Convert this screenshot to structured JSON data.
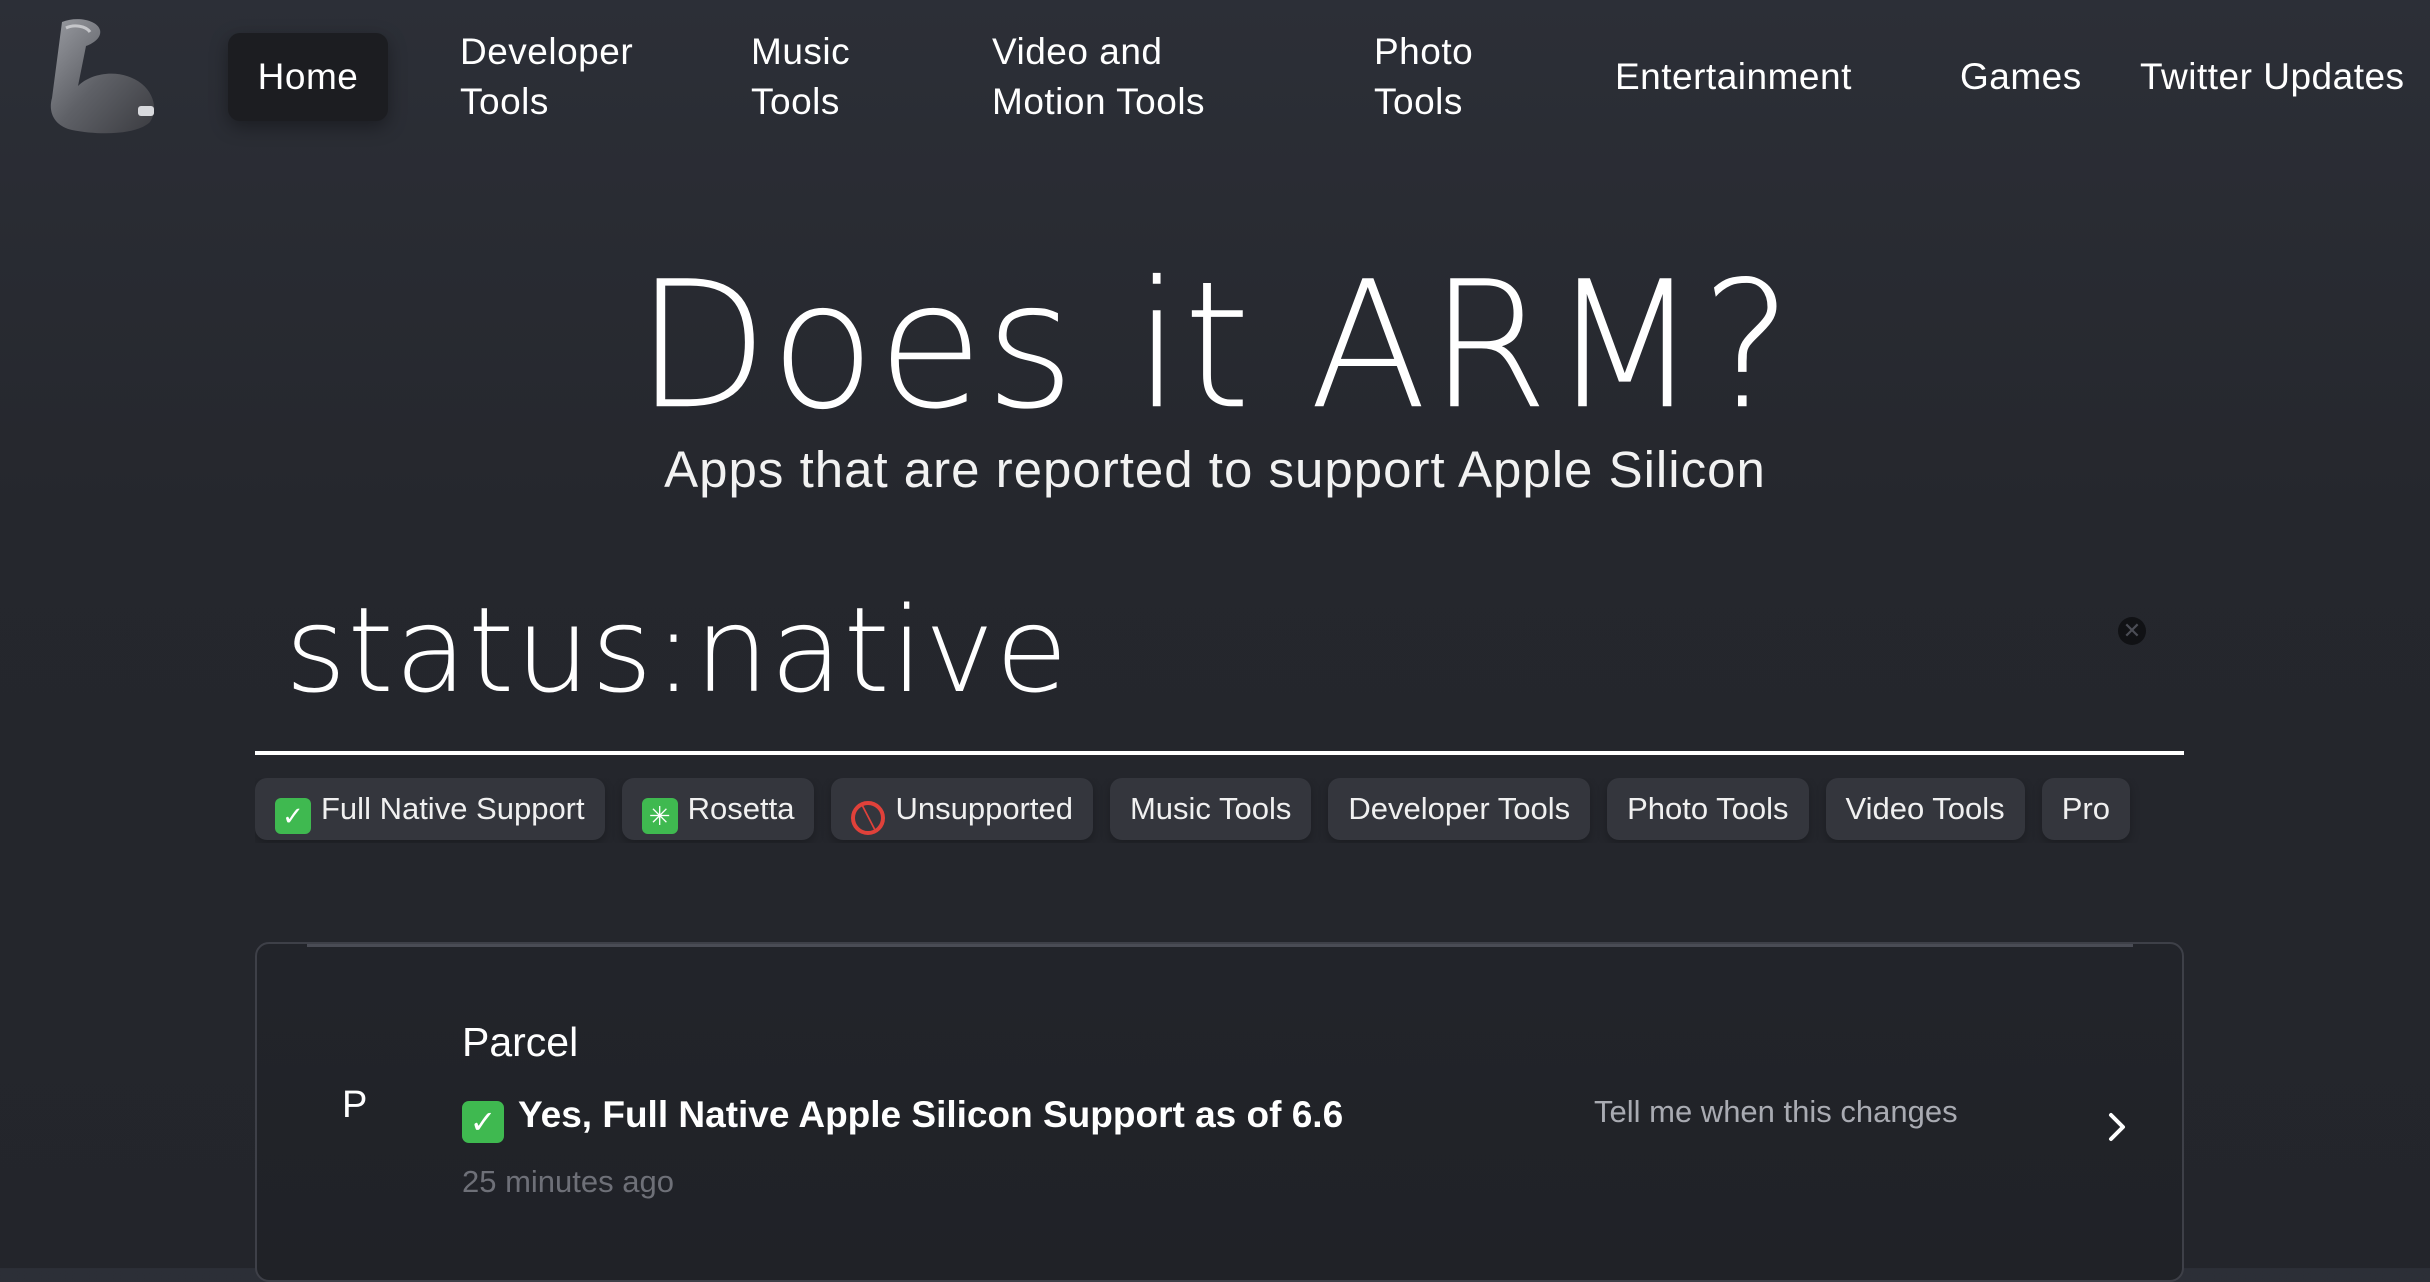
{
  "nav": {
    "logo_icon": "flexed-biceps-icon",
    "items": [
      {
        "label": "Home",
        "active": true
      },
      {
        "label": "Developer Tools"
      },
      {
        "label": "Music Tools"
      },
      {
        "label": "Video and Motion Tools"
      },
      {
        "label": "Photo Tools"
      },
      {
        "label": "Entertainment"
      },
      {
        "label": "Games"
      },
      {
        "label": "Twitter Updates"
      }
    ],
    "lines": {
      "developer": [
        "Developer",
        "Tools"
      ],
      "music": [
        "Music",
        "Tools"
      ],
      "video": [
        "Video and",
        "Motion Tools"
      ],
      "photo": [
        "Photo",
        "Tools"
      ]
    }
  },
  "hero": {
    "title": "Does it ARM?",
    "subtitle": "Apps that are reported to support Apple Silicon"
  },
  "search": {
    "value": "status:native",
    "clear_icon": "close-circle-icon"
  },
  "filters": [
    {
      "label": "Full Native Support",
      "icon": "check-mark-icon"
    },
    {
      "label": "Rosetta",
      "icon": "eight-spoked-asterisk-icon"
    },
    {
      "label": "Unsupported",
      "icon": "prohibited-icon"
    },
    {
      "label": "Music Tools"
    },
    {
      "label": "Developer Tools"
    },
    {
      "label": "Photo Tools"
    },
    {
      "label": "Video Tools"
    },
    {
      "label": "Pro"
    }
  ],
  "results": [
    {
      "avatar": "P",
      "name": "Parcel",
      "status": "Yes, Full Native Apple Silicon Support as of 6.6",
      "time": "25 minutes ago",
      "notify": "Tell me when this changes"
    }
  ],
  "colors": {
    "background": "#25272d",
    "chip": "#34363d",
    "native_green": "#3fb950",
    "unsupported_red": "#e0413a"
  }
}
